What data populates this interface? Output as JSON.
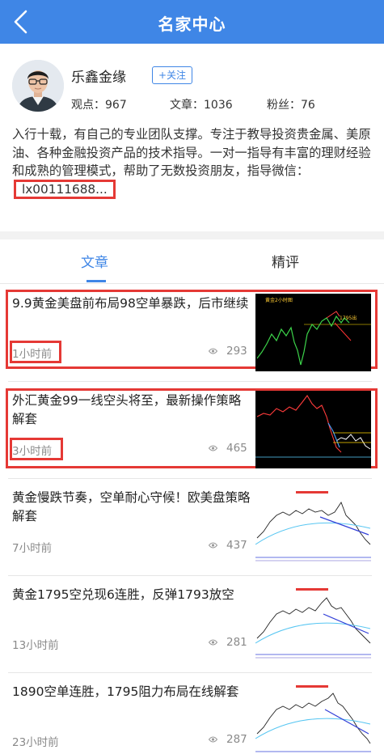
{
  "header": {
    "title": "名家中心",
    "back_icon": "chevron-left-icon"
  },
  "profile": {
    "name": "乐鑫金缘",
    "follow_label": "+关注",
    "stats": [
      {
        "label": "观点",
        "value": "967"
      },
      {
        "label": "文章",
        "value": "1036"
      },
      {
        "label": "粉丝",
        "value": "76"
      }
    ],
    "bio": "入行十载，有自己的专业团队支撑。专注于教导投资贵金属、美原油、各种金融投资产品的技术指导。一对一指导有丰富的理财经验和成熟的管理模式，帮助了无数投资朋友，指导微信：",
    "wechat": "lx00111688..."
  },
  "tabs": [
    {
      "label": "文章",
      "active": true
    },
    {
      "label": "精评",
      "active": false
    }
  ],
  "articles": [
    {
      "title": "9.9黄金美盘前布局98空单暴跌，后市继续",
      "time": "1小时前",
      "views": "293",
      "chart_title": "黄金2小时图",
      "chart_label": "1795出",
      "style": "dark",
      "highlighted": true
    },
    {
      "title": "外汇黄金99一线空头将至，最新操作策略解套",
      "time": "3小时前",
      "views": "465",
      "style": "dark2",
      "highlighted": true
    },
    {
      "title": "黄金慢跌节奏，空单耐心守候！欧美盘策略解套",
      "time": "7小时前",
      "views": "437",
      "style": "light",
      "highlighted": false
    },
    {
      "title": "黄金1795空兑现6连胜，反弹1793放空",
      "time": "13小时前",
      "views": "281",
      "style": "light",
      "highlighted": false
    },
    {
      "title": "1890空单连胜，1795阻力布局在线解套",
      "time": "23小时前",
      "views": "287",
      "style": "light",
      "highlighted": false
    }
  ],
  "colors": {
    "accent": "#3f86e6",
    "highlight": "#e53935"
  }
}
